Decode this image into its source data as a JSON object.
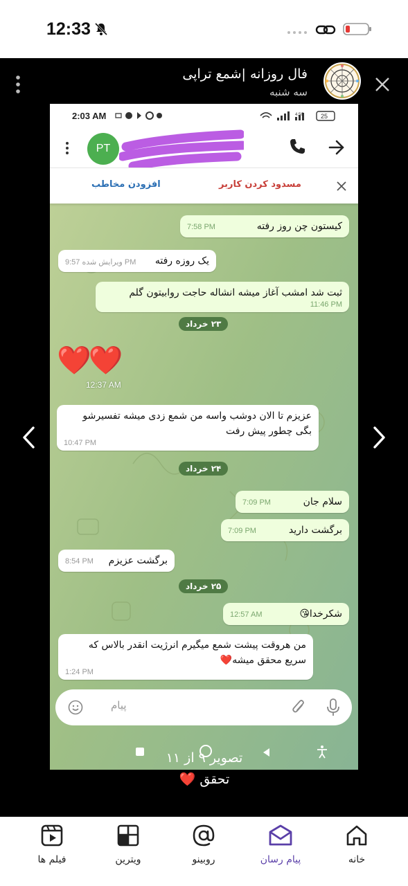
{
  "status_bar": {
    "time": "12:33"
  },
  "viewer": {
    "title": "فال روزانه |شمع تراپی",
    "subtitle": "سه شنبه",
    "caption_count": "تصویر ۹ از ۱۱",
    "caption_text": "تحقق ❤️"
  },
  "screenshot": {
    "status_time": "2:03 AM",
    "battery": "25",
    "contact_initials": "PT",
    "actions": {
      "add_contact": "افزودن مخاطب",
      "block_user": "مسدود کردن کاربر"
    },
    "input_placeholder": "پیام",
    "messages": [
      {
        "id": "m1",
        "dir": "out",
        "text": "کیستون چن روز رفته",
        "time": "7:58 PM"
      },
      {
        "id": "m2",
        "dir": "in",
        "text": "یک روزه رفته",
        "time": "ویرایش شده 9:57 PM"
      },
      {
        "id": "m3",
        "dir": "out",
        "text": "ثبت شد امشب آغاز میشه انشاله حاجت روابیتون گلم",
        "time": "11:46 PM"
      },
      {
        "id": "d1",
        "dir": "date",
        "text": "۲۳ خرداد"
      },
      {
        "id": "m4",
        "dir": "hearts",
        "text": "❤️❤️",
        "time": "12:37 AM"
      },
      {
        "id": "m5",
        "dir": "in",
        "text": "عزیزم تا الان دوشب واسه من شمع زدی میشه تفسیرشو بگی چطور پیش رفت",
        "time": "10:47 PM"
      },
      {
        "id": "d2",
        "dir": "date",
        "text": "۲۴ خرداد"
      },
      {
        "id": "m6",
        "dir": "out",
        "text": "سلام جان",
        "time": "7:09 PM"
      },
      {
        "id": "m7",
        "dir": "out",
        "text": "برگشت دارید",
        "time": "7:09 PM"
      },
      {
        "id": "m8",
        "dir": "in",
        "text": "برگشت عزیزم",
        "time": "8:54 PM"
      },
      {
        "id": "d3",
        "dir": "date",
        "text": "۲۵ خرداد"
      },
      {
        "id": "m9",
        "dir": "out",
        "text": "شکرخدا😘",
        "time": "12:57 AM"
      },
      {
        "id": "m10",
        "dir": "in",
        "text": "من هروقت پیشت شمع میگیرم انرژیت انقدر بالاس که سریع محقق میشه❤️",
        "time": "1:24 PM"
      }
    ]
  },
  "bottom_nav": [
    {
      "label": "خانه",
      "icon": "home-icon"
    },
    {
      "label": "پیام رسان",
      "icon": "messenger-icon",
      "active": true
    },
    {
      "label": "روبینو",
      "icon": "rubino-icon"
    },
    {
      "label": "ویترین",
      "icon": "showcase-icon"
    },
    {
      "label": "فیلم ها",
      "icon": "films-icon"
    }
  ],
  "colors": {
    "accent": "#5a3fa8",
    "chat_bg": "#a9c18c",
    "out_bubble": "#effedd",
    "date_chip": "#4f7a44"
  }
}
